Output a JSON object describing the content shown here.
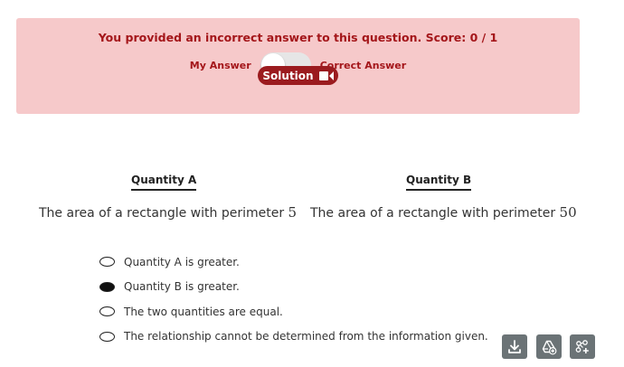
{
  "feedback": {
    "message": "You provided an incorrect answer to this question. Score: 0 / 1",
    "toggle_left_label": "My Answer",
    "toggle_right_label": "Correct Answer",
    "toggle_on": false,
    "solution_label": "Solution",
    "banner_color": "#f6c9ca",
    "text_color": "#a4161a",
    "button_color": "#9b1b1f"
  },
  "quantities": {
    "a": {
      "heading": "Quantity A",
      "text": "The area of a rectangle with perimeter",
      "value": "5"
    },
    "b": {
      "heading": "Quantity B",
      "text": "The area of a rectangle with perimeter",
      "value": "50"
    }
  },
  "options": [
    {
      "label": "Quantity A is greater.",
      "selected": false
    },
    {
      "label": "Quantity B is greater.",
      "selected": true
    },
    {
      "label": "The two quantities are equal.",
      "selected": false
    },
    {
      "label": "The relationship cannot be determined from the information given.",
      "selected": false
    }
  ],
  "toolbar": {
    "icons": [
      "download-icon",
      "drive-add-icon",
      "network-add-icon"
    ]
  }
}
